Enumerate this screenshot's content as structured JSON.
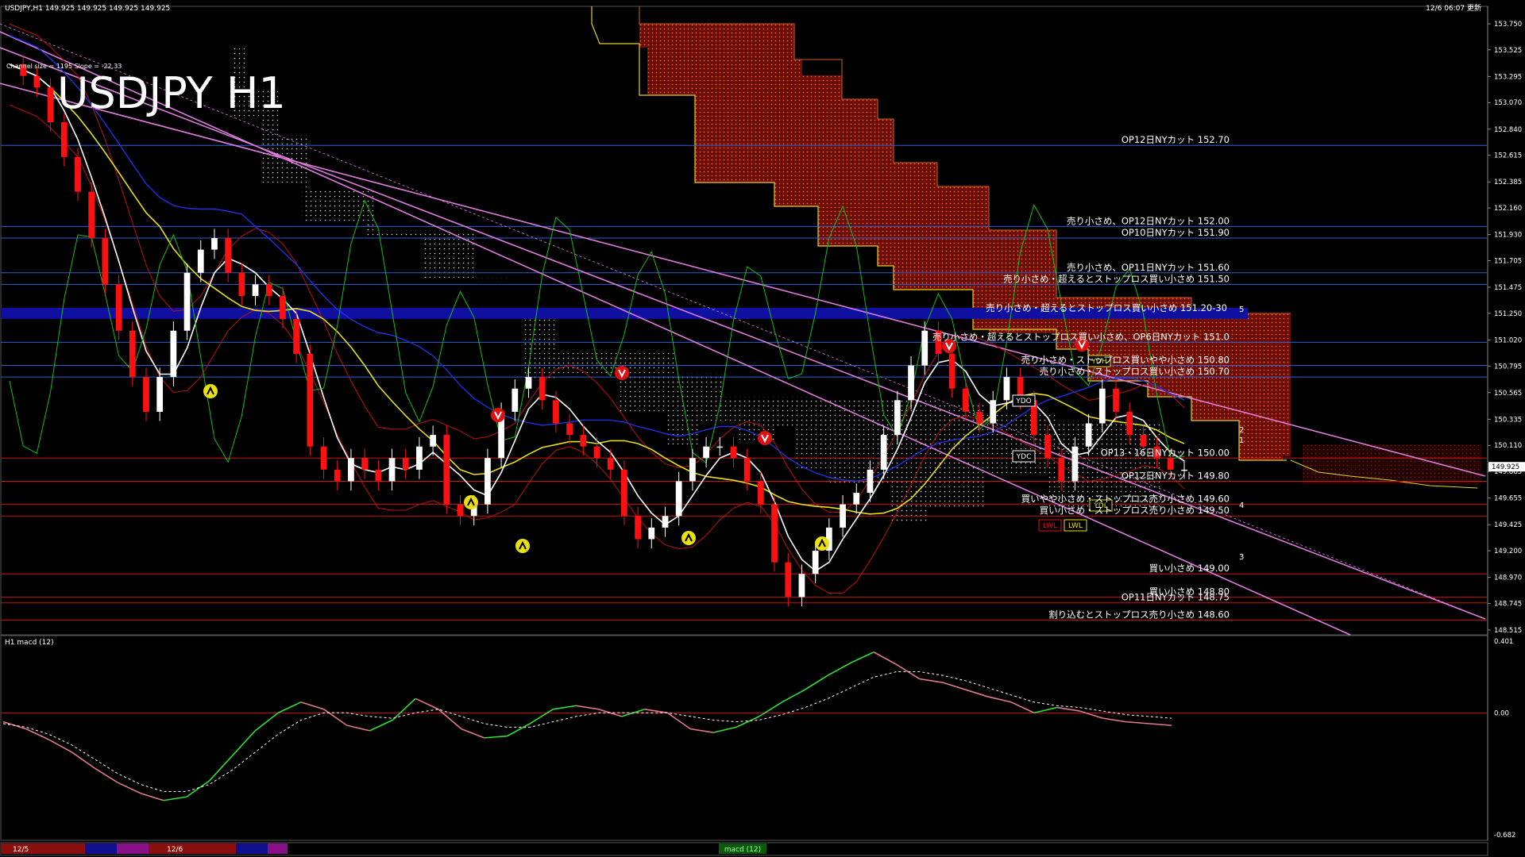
{
  "header": {
    "symbol_info": "USDJPY,H1  149.925 149.925 149.925 149.925",
    "datetime": "12/6 06:07 更新",
    "channel_info": "Channel size = 1195 Slope = -22.33",
    "big_title": "USDJPY H1"
  },
  "colors": {
    "background": "#000000",
    "grid_line": "#2a5fd0",
    "support_line": "#cc1010",
    "candle_up": "#ffffff",
    "candle_down": "#ff1010",
    "sma_white": "#ffffff",
    "sma_yellow": "#e8e010",
    "sma_blue": "#2030e0",
    "channel": "#e07ce0",
    "bollinger": "#c01010",
    "rsi_green": "#10c010",
    "kumo": "#ff4020",
    "macd_up": "#30e030",
    "macd_down": "#e07a8a"
  },
  "chart_data": [
    {
      "type": "candlestick",
      "title": "USDJPY H1",
      "ylim": [
        148.515,
        153.75
      ],
      "y_ticks": [
        "153.750",
        "153.525",
        "153.295",
        "153.070",
        "152.840",
        "152.615",
        "152.385",
        "152.160",
        "151.930",
        "151.705",
        "151.475",
        "151.250",
        "151.020",
        "150.795",
        "150.565",
        "150.335",
        "150.110",
        "149.885",
        "149.655",
        "149.425",
        "149.200",
        "148.970",
        "148.745",
        "148.515"
      ],
      "current_price": "149.925",
      "close_prices": [
        153.4,
        153.3,
        153.2,
        152.9,
        152.6,
        152.3,
        151.9,
        151.5,
        151.1,
        150.7,
        150.4,
        150.7,
        151.1,
        151.6,
        151.8,
        151.9,
        151.6,
        151.4,
        151.5,
        151.4,
        151.2,
        150.9,
        150.1,
        149.9,
        149.8,
        150.0,
        149.9,
        149.8,
        150.0,
        149.9,
        150.1,
        150.2,
        149.6,
        149.5,
        149.6,
        150.0,
        150.4,
        150.6,
        150.7,
        150.5,
        150.3,
        150.2,
        150.1,
        150.0,
        149.9,
        149.5,
        149.3,
        149.4,
        149.5,
        149.8,
        150.0,
        150.1,
        150.1,
        150.0,
        149.8,
        149.6,
        149.1,
        148.8,
        149.0,
        149.2,
        149.4,
        149.6,
        149.7,
        149.9,
        150.2,
        150.5,
        150.8,
        151.1,
        150.9,
        150.6,
        150.4,
        150.3,
        150.5,
        150.7,
        150.5,
        150.2,
        150.0,
        149.8,
        150.1,
        150.3,
        150.6,
        150.4,
        150.2,
        150.1,
        150.0,
        149.9,
        149.9
      ],
      "levels": [
        {
          "label": "OP12日NYカット 152.70",
          "price": 152.7,
          "line": "blue"
        },
        {
          "label": "売り小さめ、OP12日NYカット 152.00",
          "price": 152.0,
          "line": "blue"
        },
        {
          "label": "OP10日NYカット 151.90",
          "price": 151.9,
          "line": "blue"
        },
        {
          "label": "売り小さめ、OP11日NYカット 151.60",
          "price": 151.6,
          "line": "blue"
        },
        {
          "label": "売り小さめ・超えるとストップロス買い小さめ 151.50",
          "price": 151.5,
          "line": "blue"
        },
        {
          "label": "売り小さめ・超えるとストップロス買い小さめ 151.20-30",
          "price": 151.25,
          "line": "band"
        },
        {
          "label": "売り小さめ・超えるとストップロス買い小さめ、OP6日NYカット 151.0",
          "price": 151.0,
          "line": "blue"
        },
        {
          "label": "売り小さめ・ストップロス買いやや小さめ 150.80",
          "price": 150.8,
          "line": "blue"
        },
        {
          "label": "売り小さめ・ストップロス買い小さめ 150.70",
          "price": 150.7,
          "line": "blue"
        },
        {
          "label": "OP13・16日NYカット 150.00",
          "price": 150.0,
          "line": "red"
        },
        {
          "label": "OP12日NYカット 149.80",
          "price": 149.8,
          "line": "red"
        },
        {
          "label": "買いやや小さめ・ストップロス売り小さめ 149.60",
          "price": 149.6,
          "line": "red"
        },
        {
          "label": "買い小さめ・ストップロス売り小さめ 149.50",
          "price": 149.5,
          "line": "red"
        },
        {
          "label": "買い小さめ 149.00",
          "price": 149.0,
          "line": "red"
        },
        {
          "label": "買い小さめ 148.80",
          "price": 148.8,
          "line": "red"
        },
        {
          "label": "OP11日NYカット 148.75",
          "price": 148.75,
          "line": "red"
        },
        {
          "label": "割り込むとストップロス売り小さめ 148.60",
          "price": 148.6,
          "line": "red"
        }
      ],
      "channel_labels": [
        "5",
        "2",
        "1",
        "4",
        "3"
      ],
      "markers": [
        "YDO",
        "YDC",
        "YDH",
        "YDL",
        "LWL",
        "LWL"
      ]
    },
    {
      "type": "line",
      "title": "H1  macd (12)",
      "ylim": [
        -0.682,
        0.401
      ],
      "y_ticks": [
        "0.401",
        "0.00",
        "-0.682"
      ],
      "series": [
        {
          "values": [
            -0.05,
            -0.09,
            -0.15,
            -0.22,
            -0.31,
            -0.39,
            -0.45,
            -0.49,
            -0.47,
            -0.38,
            -0.24,
            -0.1,
            0.0,
            0.06,
            0.02,
            -0.07,
            -0.1,
            -0.04,
            0.08,
            0.02,
            -0.09,
            -0.14,
            -0.13,
            -0.06,
            0.02,
            0.04,
            0.02,
            -0.02,
            0.02,
            0.0,
            -0.09,
            -0.11,
            -0.08,
            -0.02,
            0.06,
            0.13,
            0.21,
            0.28,
            0.34,
            0.27,
            0.19,
            0.17,
            0.13,
            0.09,
            0.06,
            0.0,
            0.03,
            0.01,
            -0.03,
            -0.05,
            -0.06,
            -0.07
          ]
        },
        {
          "values": [
            -0.06,
            -0.08,
            -0.12,
            -0.18,
            -0.26,
            -0.34,
            -0.4,
            -0.44,
            -0.44,
            -0.4,
            -0.32,
            -0.22,
            -0.12,
            -0.04,
            0.0,
            0.0,
            -0.02,
            -0.03,
            0.0,
            0.02,
            -0.02,
            -0.06,
            -0.08,
            -0.08,
            -0.05,
            -0.02,
            0.0,
            0.0,
            0.0,
            0.0,
            -0.02,
            -0.04,
            -0.05,
            -0.04,
            -0.01,
            0.03,
            0.08,
            0.14,
            0.2,
            0.23,
            0.23,
            0.21,
            0.18,
            0.14,
            0.1,
            0.06,
            0.04,
            0.03,
            0.01,
            -0.01,
            -0.02,
            -0.03
          ]
        }
      ]
    }
  ],
  "bottom_bar": {
    "date_1": "12/5",
    "date_2": "12/6",
    "tab_label": "macd (12)"
  }
}
